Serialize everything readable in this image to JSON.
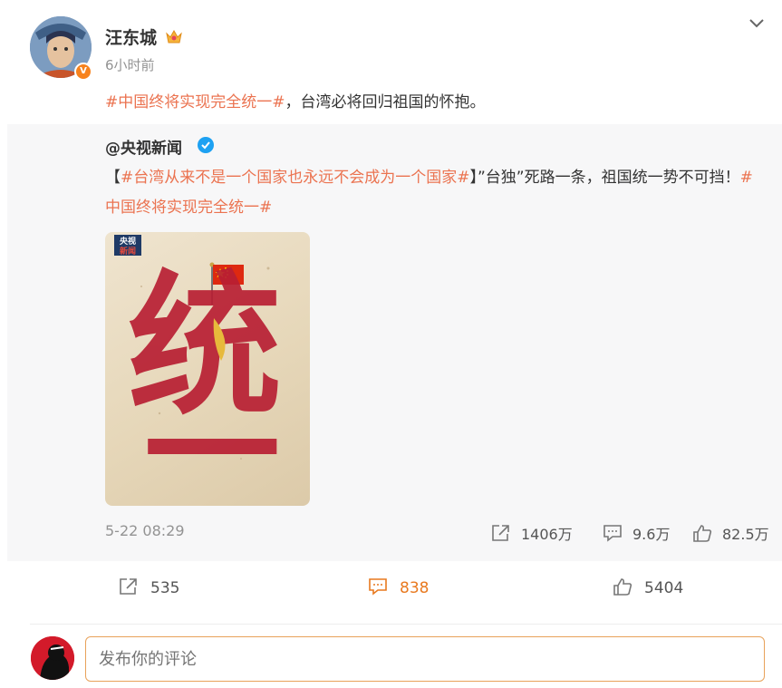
{
  "post": {
    "author": "汪东城",
    "time": "6小时前",
    "topic": "#中国终将实现完全统一#",
    "text_after_topic": "，台湾必将回归祖国的怀抱。"
  },
  "repost": {
    "author": "@央视新闻",
    "bracket_open": "【",
    "topic1": "#台湾从来不是一个国家也永远不会成为一个国家#",
    "bracket_close": "】",
    "text": "”台独”死路一条，祖国统一势不可挡！",
    "topic2": "#中国终将实现完全统一#",
    "image": {
      "logo_top": "央视",
      "logo_bottom": "新闻",
      "calligraphy_line1": "统",
      "calligraphy_line2": "一"
    },
    "date": "5-22 08:29",
    "stats": {
      "shares": "1406万",
      "comments": "9.6万",
      "likes": "82.5万"
    }
  },
  "actions": {
    "share_count": "535",
    "comment_count": "838",
    "like_count": "5404"
  },
  "comment_box": {
    "placeholder": "发布你的评论"
  },
  "colors": {
    "topic": "#eb7350",
    "accent": "#e8791f",
    "verified_orange": "#f7821c",
    "verified_blue": "#1da1f2"
  }
}
